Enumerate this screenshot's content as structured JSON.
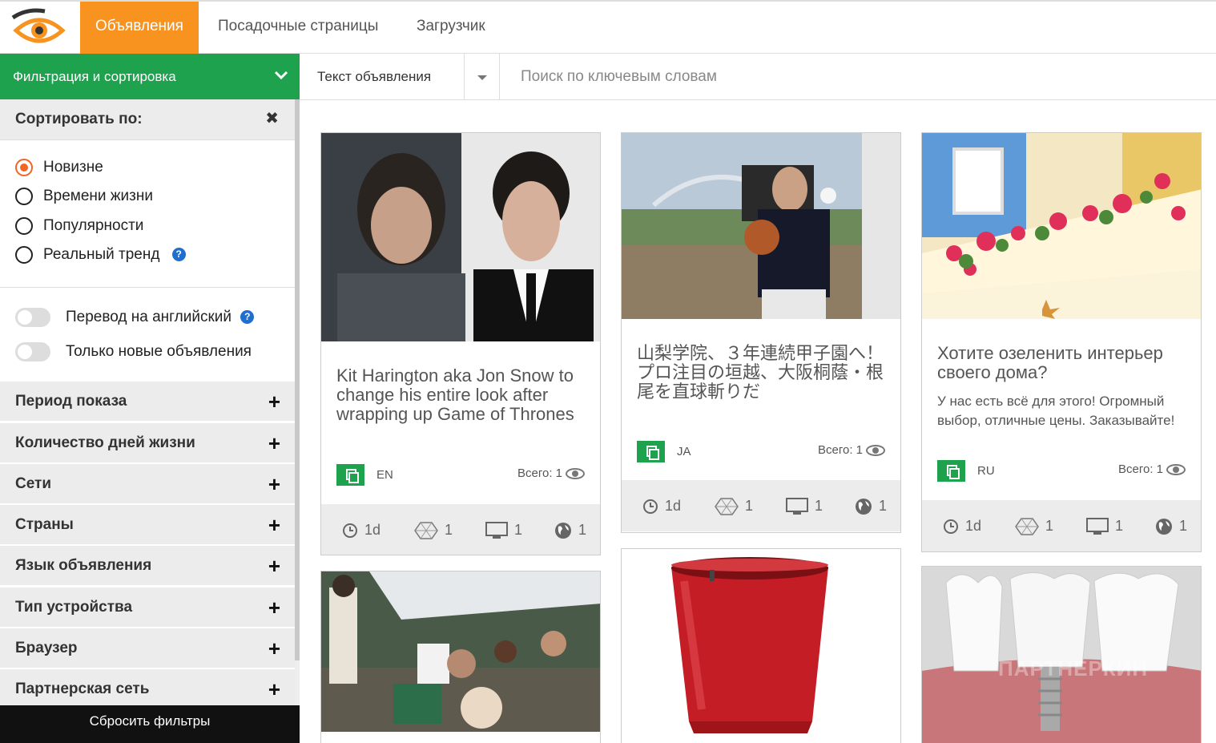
{
  "nav": {
    "tabs": [
      {
        "label": "Объявления",
        "active": true
      },
      {
        "label": "Посадочные страницы",
        "active": false
      },
      {
        "label": "Загрузчик",
        "active": false
      }
    ]
  },
  "filter_bar": {
    "title": "Фильтрация и сортировка"
  },
  "search": {
    "select_value": "Текст объявления",
    "placeholder": "Поиск по ключевым словам"
  },
  "sidebar": {
    "sort_title": "Сортировать по:",
    "sort_options": [
      {
        "label": "Новизне",
        "checked": true
      },
      {
        "label": "Времени жизни",
        "checked": false
      },
      {
        "label": "Популярности",
        "checked": false
      },
      {
        "label": "Реальный тренд",
        "checked": false
      }
    ],
    "toggles": [
      {
        "label": "Перевод на английский",
        "on": false
      },
      {
        "label": "Только новые объявления",
        "on": false
      }
    ],
    "sections": [
      "Период показа",
      "Количество дней жизни",
      "Сети",
      "Страны",
      "Язык объявления",
      "Тип устройства",
      "Браузер",
      "Партнерская сеть"
    ],
    "reset_label": "Сбросить фильтры"
  },
  "cards": [
    {
      "title": "Kit Harington aka Jon Snow to change his entire look after wrapping up Game of Thrones",
      "desc": "",
      "lang": "EN",
      "total_label": "Всего: 1",
      "stats": {
        "age": "1d",
        "networks": "1",
        "devices": "1",
        "countries": "1"
      }
    },
    {
      "title": "山梨学院、３年連続甲子園へ！プロ注目の垣越、大阪桐蔭・根尾を直球斬りだ",
      "desc": "",
      "lang": "JA",
      "total_label": "Всего: 1",
      "stats": {
        "age": "1d",
        "networks": "1",
        "devices": "1",
        "countries": "1"
      }
    },
    {
      "title": "Хотите озеленить интерьер своего дома?",
      "desc": "У нас есть всё для этого! Огромный выбор, отличные цены. Заказывайте!",
      "lang": "RU",
      "total_label": "Всего: 1",
      "stats": {
        "age": "1d",
        "networks": "1",
        "devices": "1",
        "countries": "1"
      }
    }
  ],
  "colors": {
    "accent_orange": "#f7931e",
    "accent_green": "#1ea24e",
    "dark": "#111111"
  },
  "watermark": "ПАРТНЕРКИН"
}
